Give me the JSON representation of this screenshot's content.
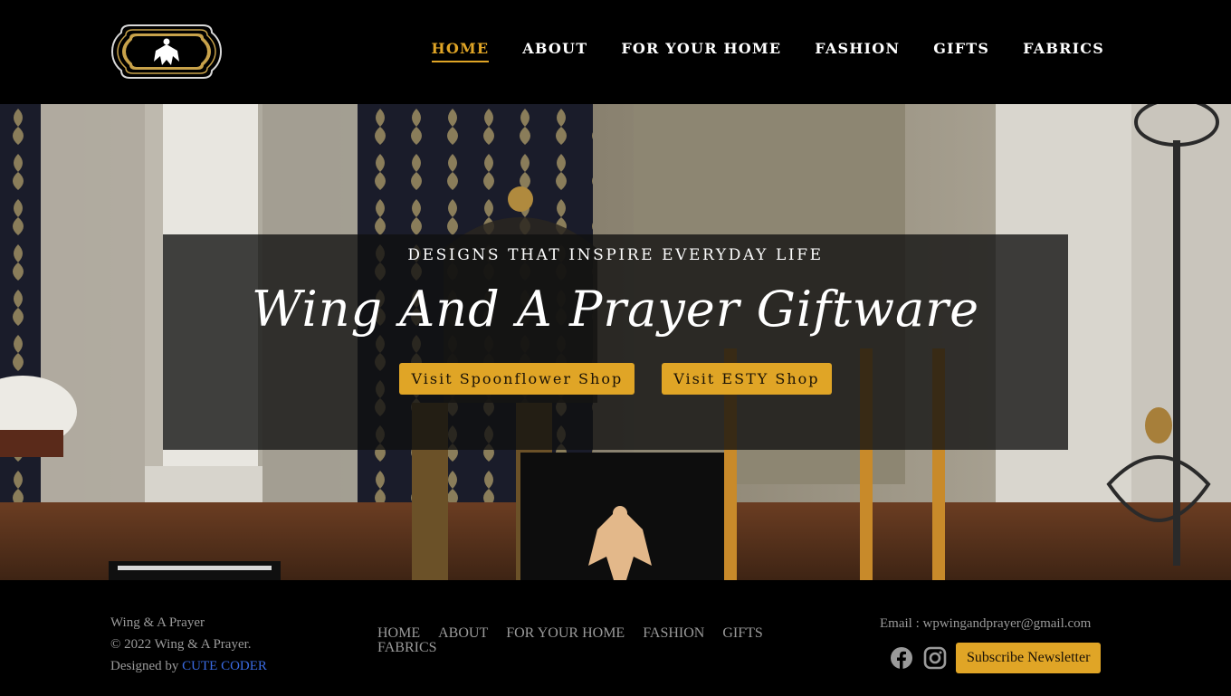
{
  "header": {
    "logo_alt": "Wing & A Prayer logo",
    "nav": [
      {
        "label": "HOME",
        "active": true
      },
      {
        "label": "ABOUT"
      },
      {
        "label": "FOR YOUR HOME"
      },
      {
        "label": "FASHION"
      },
      {
        "label": "GIFTS"
      },
      {
        "label": "FABRICS"
      }
    ]
  },
  "hero": {
    "tagline": "DESIGNS THAT INSPIRE EVERYDAY LIFE",
    "title": "Wing And A Prayer Giftware",
    "buttons": {
      "spoonflower": "Visit Spoonflower Shop",
      "etsy": "Visit ESTY Shop"
    }
  },
  "footer": {
    "brand": "Wing & A Prayer",
    "copyright": "© 2022 Wing & A Prayer.",
    "designed_by_prefix": "Designed by",
    "designer": "CUTE CODER",
    "nav": [
      "HOME",
      "ABOUT",
      "FOR YOUR HOME",
      "FASHION",
      "GIFTS",
      "FABRICS"
    ],
    "email": "Email : wpwingandprayer@gmail.com",
    "subscribe": "Subscribe Newsletter",
    "socials": [
      "facebook-icon",
      "instagram-icon"
    ]
  },
  "colors": {
    "accent": "#e0a526",
    "background": "#000000",
    "link": "#3a6be3"
  }
}
